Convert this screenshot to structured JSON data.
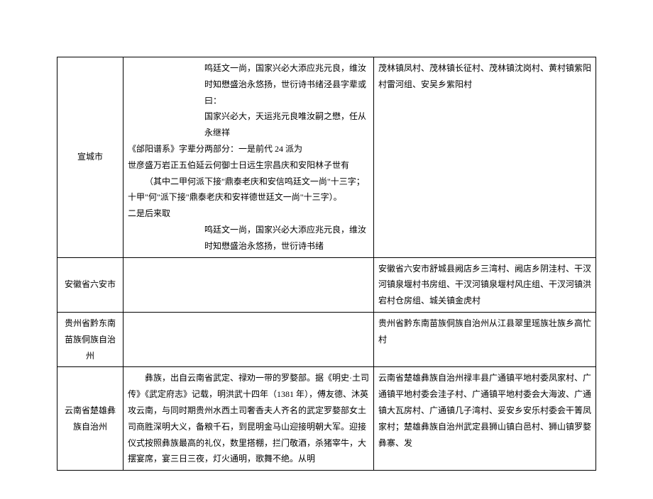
{
  "rows": [
    {
      "region": "宣城市",
      "desc_lines": [
        {
          "cls": "indent-6",
          "text": "鸣廷文一尚，国家兴必大添应兆元良，维汝时知懋盛治永悠扬，世衍诗书绪泾县字辈或曰："
        },
        {
          "cls": "indent-6",
          "text": "国家兴必大，天运兆元良唯汝嗣之懋，任从永继祥"
        },
        {
          "cls": "",
          "text": "《邰阳谱系》字辈分两部分：一是前代 24 派为"
        },
        {
          "cls": "",
          "text": "世彦盛万岩正五伯延云何御士日远生宗昌庆和安阳林子世有"
        },
        {
          "cls": "indent-1",
          "text": "（其中二甲何派下接\"鼎泰老庆和安信鸣廷文一尚\"十三字；十甲\"何\"派下接\"鼎泰老庆和安祥德世廷文一尚\"十三字）。"
        },
        {
          "cls": "",
          "text": "二是后来取"
        },
        {
          "cls": "indent-6",
          "text": "鸣廷文一尚，国家兴必大添应兆元良，维汝时知懋盛治永悠扬，世衍诗书绪"
        }
      ],
      "villages": "茂林镇凤村、茂林镇长征村、茂林镇沈岗村、黄村镇紫阳村雷河组、安吴乡紫阳村"
    },
    {
      "region": "安徽省六安市",
      "desc_lines": [],
      "villages": "安徽省六安市舒城县阙店乡三湾村、阙店乡阴洼村、干汊河镇泉堰村书房组、干汊河镇泉堰村风庄组、干汊河镇洪宕村仓房组、城关镇金虎村"
    },
    {
      "region": "贵州省黔东南苗族侗族自治州",
      "desc_lines": [],
      "villages": "贵州省黔东南苗族侗族自治州从江县翠里瑶族壮族乡高忙村"
    },
    {
      "region": "云南省楚雄彝族自治州",
      "desc_lines": [
        {
          "cls": "indent-1",
          "text": "彝族，出自云南省武定、禄劝一带的罗婺部。据《明史·土司传》《武定府志》记载，明洪武十四年（1381 年），傅友德、沐英攻云南，与同时期贵州水西土司奢香夫人齐名的武定罗婺部女土司商胜深明大义，备粮千石，到昆明金马山迎接明朝大军。迎接仪式按照彝族最高的礼仪，数里搭棚，拦门敬酒，杀猪宰牛，大摆宴席，宴三日三夜，灯火通明，歌舞不绝。从明"
        }
      ],
      "villages": "云南省楚雄彝族自治州禄丰县广通镇平地村委凤家村、广通镇平地村委会洼子村、广通镇平地村委会大海波、广通镇大瓦房村、广通镇几子湾村、妥安乡安乐村委会干箐凤家村；楚雄彝族自治州武定县狮山镇白邑村、狮山镇罗婺彝寨、发"
    }
  ]
}
